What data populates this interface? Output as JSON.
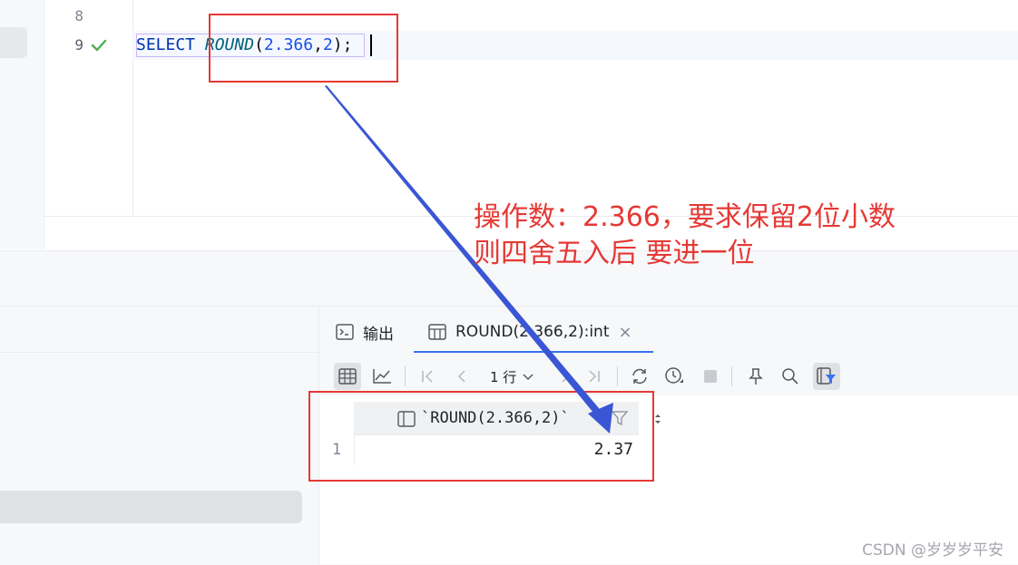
{
  "editor": {
    "line_numbers": [
      "8",
      "9"
    ],
    "code": {
      "keyword": "SELECT",
      "function": "ROUND",
      "open_paren": "(",
      "arg1": "2.366",
      "comma": ",",
      "arg2": "2",
      "close_paren": ")",
      "semicolon": ";"
    }
  },
  "results_panel": {
    "tabs": [
      {
        "label": "输出",
        "icon": "console-icon"
      },
      {
        "label": "ROUND(2.366,2):int",
        "icon": "table-icon",
        "close": "×"
      }
    ],
    "toolbar": {
      "row_count": "1 行",
      "icons": [
        "table-view-icon",
        "chart-view-icon",
        "first-page-icon",
        "prev-page-icon",
        "next-page-icon",
        "last-page-icon",
        "refresh-icon",
        "history-icon",
        "stop-icon",
        "pin-icon",
        "search-icon",
        "filter-panel-icon"
      ]
    },
    "grid": {
      "column_header": "`ROUND(2.366,2)`",
      "rows": [
        {
          "num": "1",
          "value": "2.37"
        }
      ]
    }
  },
  "annotation": {
    "line1": "操作数：2.366，要求保留2位小数",
    "line2": "则四舍五入后 要进一位",
    "color": "#e53935"
  },
  "watermark": "CSDN @岁岁岁平安"
}
